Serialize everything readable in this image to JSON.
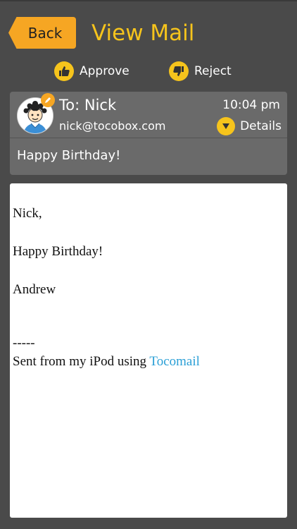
{
  "header": {
    "back_label": "Back",
    "title": "View Mail"
  },
  "actions": {
    "approve_label": "Approve",
    "reject_label": "Reject"
  },
  "mail": {
    "to_label": "To: Nick",
    "to_email": "nick@tocobox.com",
    "time": "10:04 pm",
    "details_label": "Details",
    "subject": "Happy Birthday!",
    "body": {
      "greeting": "Nick,",
      "message": "Happy Birthday!",
      "signoff": "Andrew",
      "separator": "-----",
      "footer_prefix": "Sent from my iPod using ",
      "footer_link": "Tocomail"
    }
  },
  "colors": {
    "accent": "#f6c41c",
    "back_button": "#f6a623",
    "background": "#4a4a4a",
    "link": "#2a9fd6"
  },
  "icons": [
    "thumbs-up-icon",
    "thumbs-down-icon",
    "pencil-icon",
    "chevron-down-icon",
    "avatar"
  ]
}
